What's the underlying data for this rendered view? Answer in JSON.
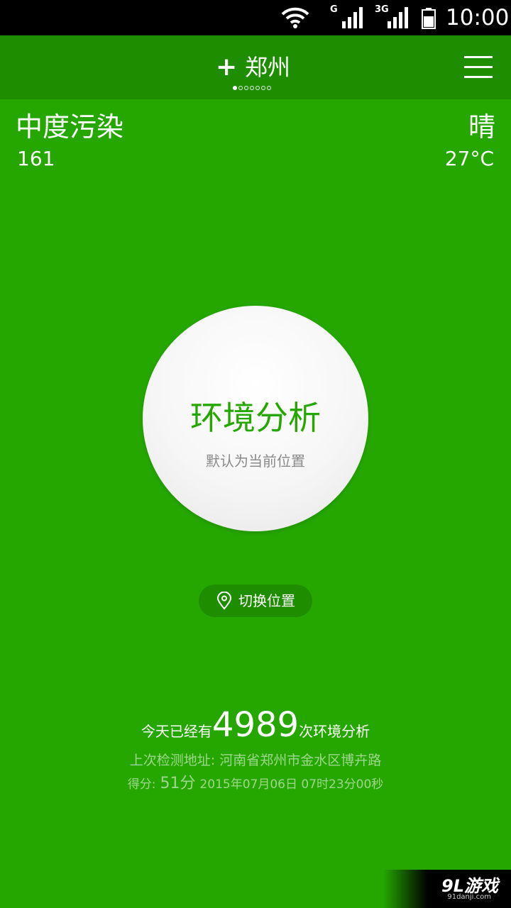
{
  "status_bar": {
    "network_1_label": "G",
    "network_2_label": "3G",
    "time": "10:00"
  },
  "app_bar": {
    "add_glyph": "+",
    "city": "郑州",
    "page_count": 7,
    "active_page": 1
  },
  "air_quality": {
    "status": "中度污染",
    "value": "161"
  },
  "weather": {
    "condition": "晴",
    "temperature": "27°C"
  },
  "analysis_button": {
    "title": "环境分析",
    "subtitle": "默认为当前位置"
  },
  "switch_location": {
    "label": "切换位置",
    "icon": "location-pin-icon"
  },
  "stats": {
    "prefix": "今天已经有",
    "count": "4989",
    "suffix": "次环境分析",
    "last_address": "上次检测地址: 河南省郑州市金水区博卉路",
    "score_label": "得分:",
    "score_value": "51分",
    "last_time": "2015年07月06日 07时23分00秒"
  },
  "watermark": {
    "logo_text": "9L游戏",
    "url": "91danji.com"
  },
  "colors": {
    "background": "#25a700",
    "app_bar": "#1f8d00",
    "accent_text": "#25a700"
  }
}
